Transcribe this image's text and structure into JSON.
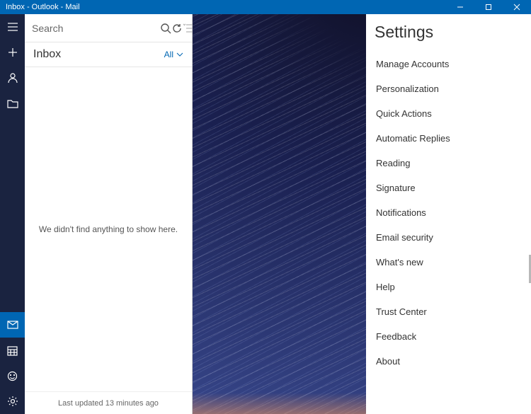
{
  "titlebar": {
    "title": "Inbox - Outlook - Mail"
  },
  "search": {
    "placeholder": "Search"
  },
  "folder": {
    "name": "Inbox",
    "filter": "All"
  },
  "list": {
    "empty_message": "We didn't find anything to show here.",
    "status": "Last updated 13 minutes ago"
  },
  "settings": {
    "title": "Settings",
    "items": [
      "Manage Accounts",
      "Personalization",
      "Quick Actions",
      "Automatic Replies",
      "Reading",
      "Signature",
      "Notifications",
      "Email security",
      "What's new",
      "Help",
      "Trust Center",
      "Feedback",
      "About"
    ]
  }
}
